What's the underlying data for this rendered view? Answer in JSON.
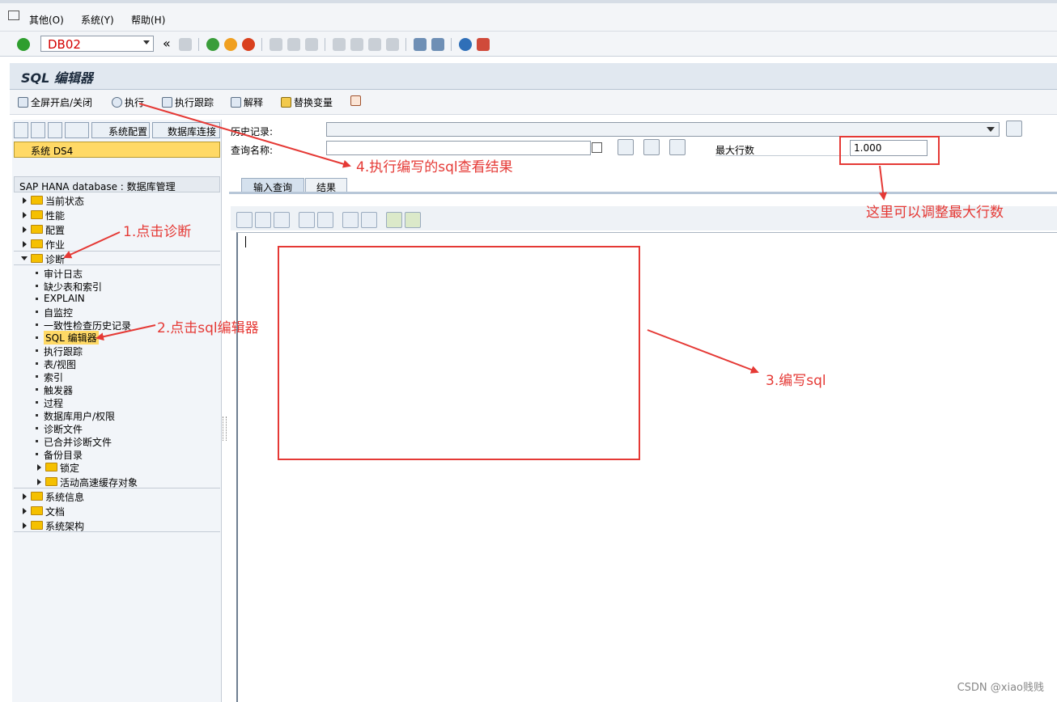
{
  "menu": [
    "其他(O)",
    "系统(Y)",
    "帮助(H)"
  ],
  "toolbar": {
    "command_value": "DB02",
    "back_glyph": "«"
  },
  "title": "SQL 编辑器",
  "app_toolbar": [
    "全屏开启/关闭",
    "执行",
    "执行跟踪",
    "解释",
    "替换变量"
  ],
  "left_panel": {
    "buttons": [
      "系统配置",
      "数据库连接"
    ],
    "system_field": "系统 DS4",
    "tree_header": "SAP HANA database : 数据库管理",
    "folders_top": [
      "当前状态",
      "性能",
      "配置",
      "作业"
    ],
    "diagnosis_label": "诊断",
    "diagnosis_items": [
      "审计日志",
      "缺少表和索引",
      "EXPLAIN",
      "自监控",
      "一致性检查历史记录",
      "SQL 编辑器",
      "执行跟踪",
      "表/视图",
      "索引",
      "触发器",
      "过程",
      "数据库用户/权限",
      "诊断文件",
      "已合并诊断文件",
      "备份目录"
    ],
    "diagnosis_subfolders": [
      "锁定",
      "活动高速缓存对象"
    ],
    "folders_bottom": [
      "系统信息",
      "文档",
      "系统架构"
    ]
  },
  "form": {
    "history_label": "历史记录:",
    "query_name_label": "查询名称:",
    "max_rows_label": "最大行数",
    "max_rows_value": "1.000"
  },
  "tabs": [
    "输入查询",
    "结果"
  ],
  "annotations": {
    "a1": "1.点击诊断",
    "a2": "2.点击sql编辑器",
    "a3": "3.编写sql",
    "a4": "4.执行编写的sql查看结果",
    "a5": "这里可以调整最大行数"
  },
  "watermark": "CSDN @xiao贱贱",
  "colors": {
    "accent": "#e53935",
    "selected": "#ffd966",
    "folder": "#f5c000",
    "command_text": "#d40000"
  }
}
